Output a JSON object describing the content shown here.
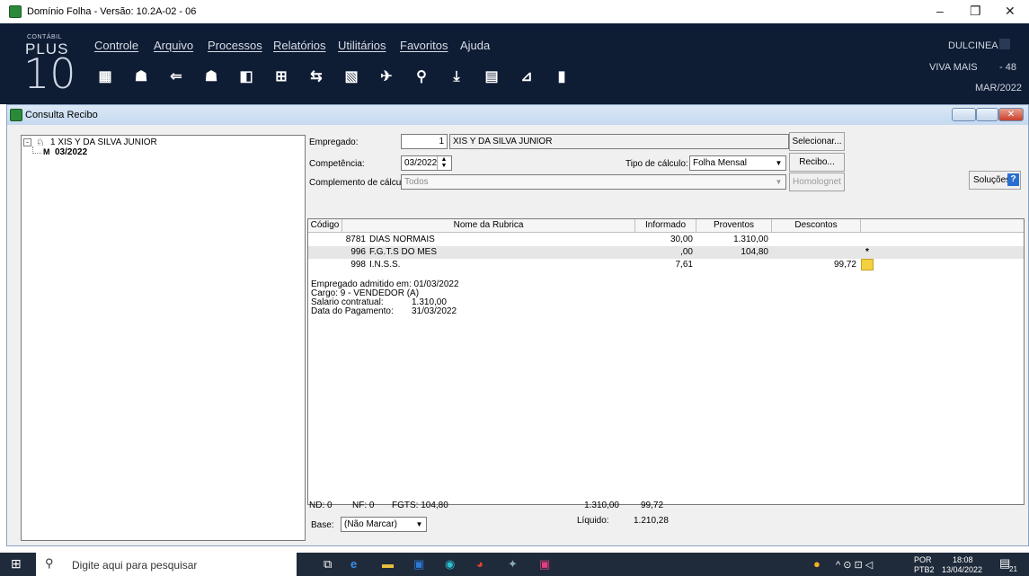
{
  "titlebar": {
    "title": "Domínio Folha - Versão: 10.2A-02 - 06",
    "minimize": "–",
    "restore": "❐",
    "close": "✕"
  },
  "logo": {
    "small": "CONTÁBIL",
    "plus": "PLUS",
    "num": "10"
  },
  "menu": [
    "Controle",
    "Arquivo",
    "Processos",
    "Relatórios",
    "Utilitários",
    "Favoritos",
    "Ajuda"
  ],
  "toolbar_icons": [
    "building-icon",
    "user-icon",
    "import-icon",
    "users-icon",
    "exit-icon",
    "calculator-list-icon",
    "transfer-icon",
    "document-icon",
    "plane-icon",
    "search-icon",
    "download-icon",
    "calculator-icon",
    "chart-icon",
    "door-icon"
  ],
  "header_right": {
    "user": "DULCINEA",
    "company": "VIVA MAIS",
    "company_code": "- 48",
    "period": "MAR/2022"
  },
  "window": {
    "title": "Consulta Recibo"
  },
  "tree": {
    "root": "1 XIS Y DA SILVA JUNIOR",
    "child": "03/2022"
  },
  "form": {
    "employee_label": "Empregado:",
    "employee_code": "1",
    "employee_name": "XIS Y DA SILVA JUNIOR",
    "competence_label": "Competência:",
    "competence_value": "03/2022",
    "calc_type_label": "Tipo de cálculo:",
    "calc_type_value": "Folha Mensal",
    "complement_label": "Complemento de cálculo:",
    "complement_value": "Todos",
    "select_button": "Selecionar...",
    "receipt_button": "Recibo...",
    "homolognet_button": "Homolognet",
    "solutions_button": "Soluções"
  },
  "grid": {
    "headers": [
      "Código",
      "Nome da Rubrica",
      "Informado",
      "Proventos",
      "Descontos"
    ],
    "rows": [
      {
        "code": "8781",
        "name": "DIAS NORMAIS",
        "informed": "30,00",
        "earnings": "1.310,00",
        "deductions": "",
        "mark": ""
      },
      {
        "code": "996",
        "name": "F.G.T.S  DO MES",
        "informed": ",00",
        "earnings": "104,80",
        "deductions": "",
        "mark": "*"
      },
      {
        "code": "998",
        "name": "I.N.S.S.",
        "informed": "7,61",
        "earnings": "",
        "deductions": "99,72",
        "mark": ""
      }
    ],
    "info": [
      "Empregado admitido em:  01/03/2022",
      "Cargo: 9 - VENDEDOR (A)",
      "Salario contratual:",
      "Data do Pagamento:"
    ],
    "info_values": [
      "",
      "",
      "1.310,00",
      "31/03/2022"
    ]
  },
  "footer": {
    "nd": "ND:  0",
    "nf": "NF:  0",
    "fgts": "FGTS:  104,80",
    "total_earnings": "1.310,00",
    "total_deductions": "99,72",
    "net_label": "Líquido:",
    "net_value": "1.210,28",
    "base_label": "Base:",
    "base_value": "(Não Marcar)"
  },
  "taskbar": {
    "search_placeholder": "Digite aqui para pesquisar",
    "lang": "POR",
    "lang2": "PTB2",
    "time": "18:08",
    "date": "13/04/2022",
    "notif": "21"
  }
}
